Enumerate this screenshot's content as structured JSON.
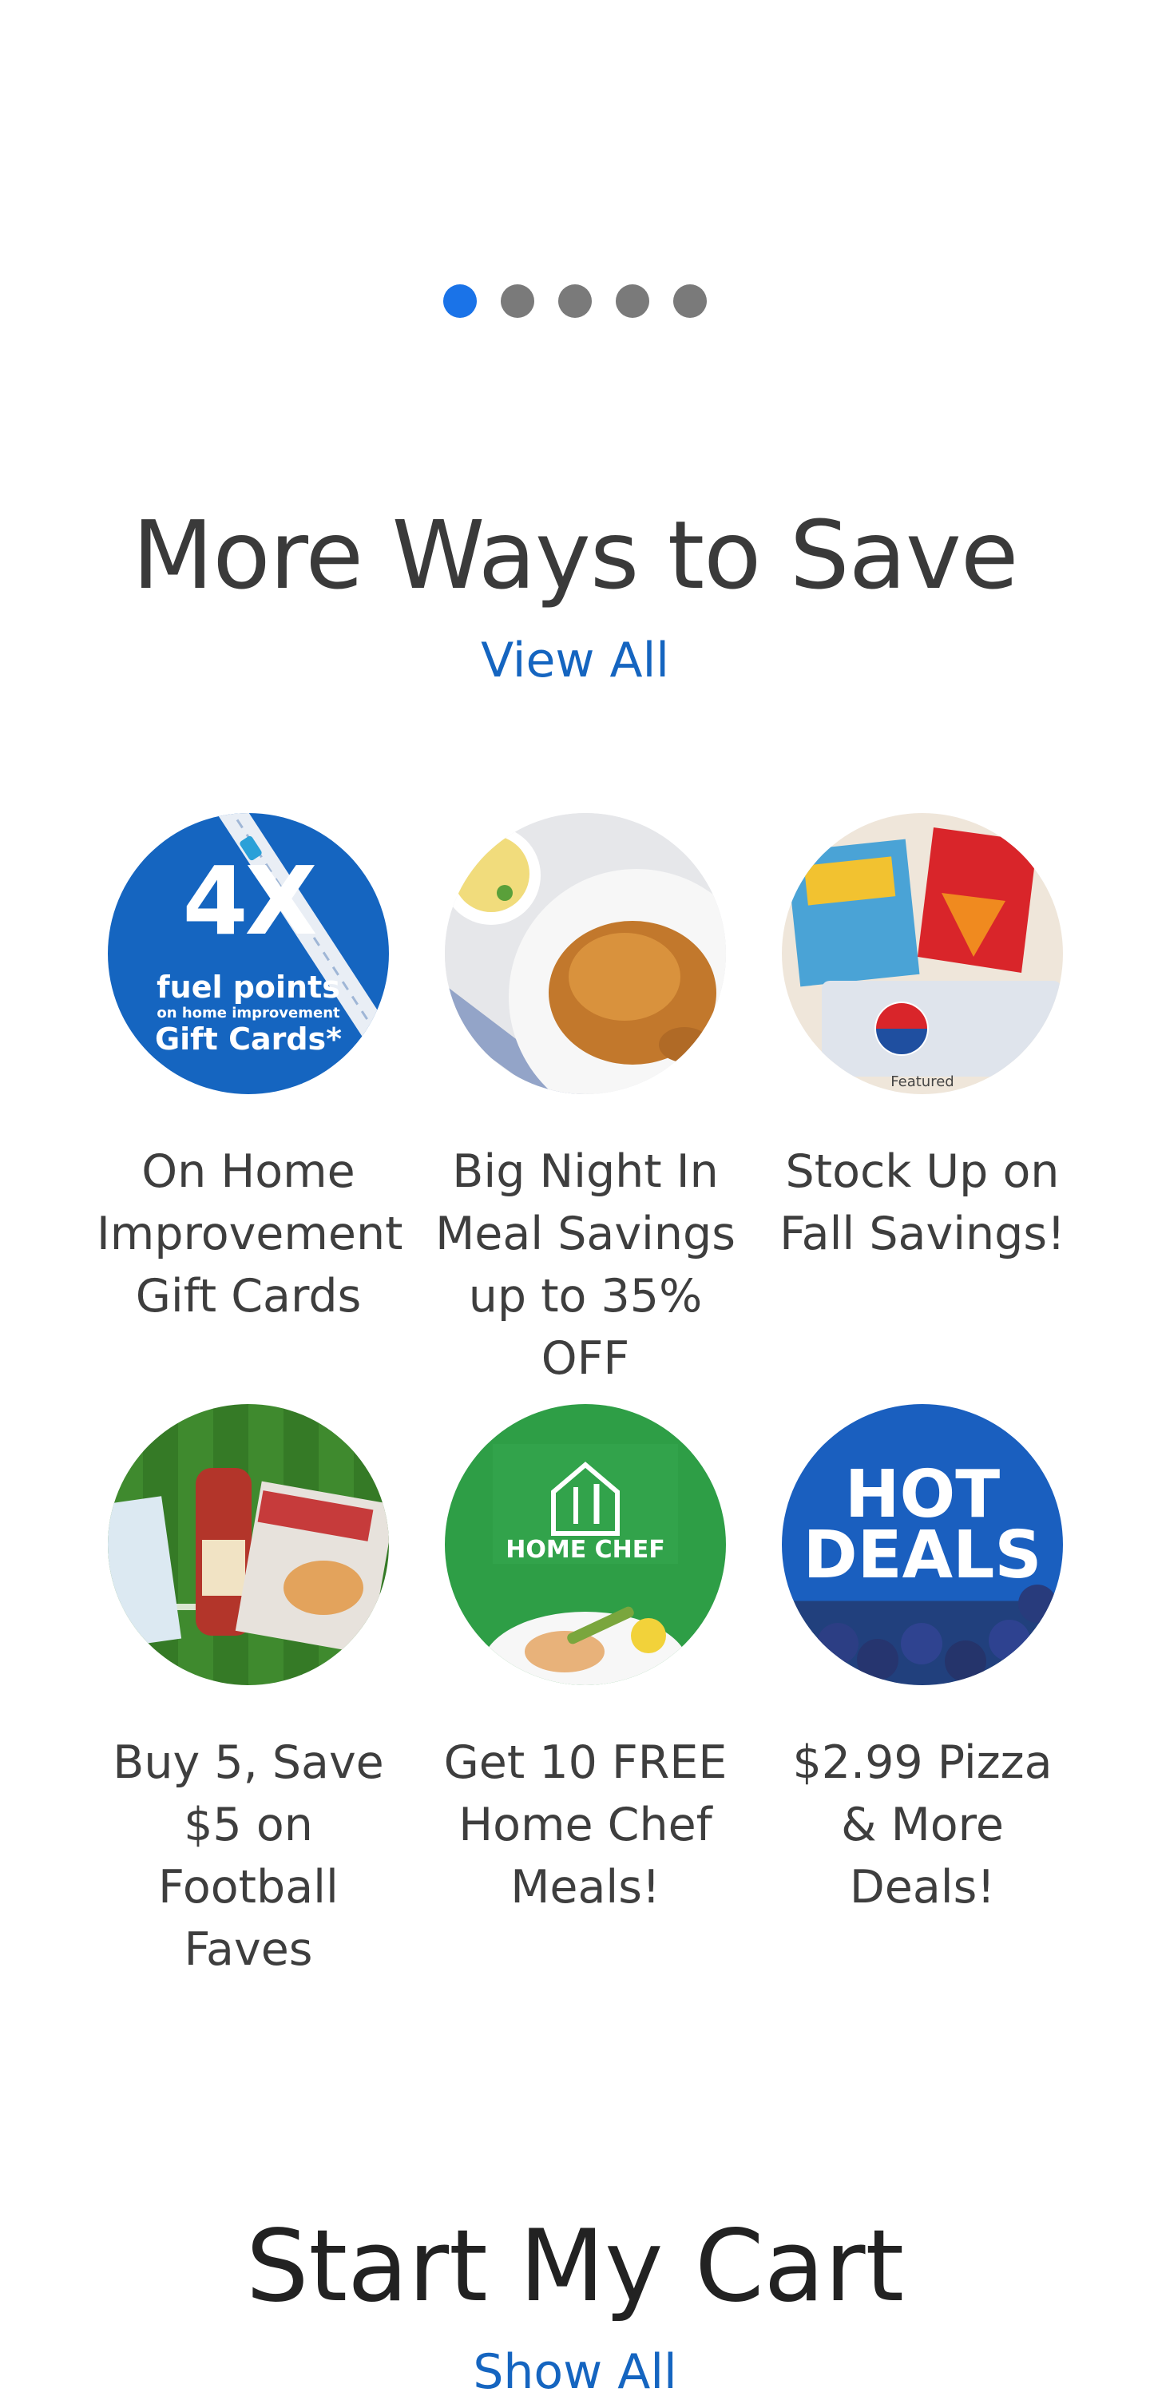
{
  "carousel": {
    "dot_count": 5,
    "active_index": 0
  },
  "more_ways": {
    "title": "More Ways to Save",
    "view_all": "View All",
    "tiles": [
      {
        "label": "On Home Improvement Gift Cards",
        "art_text": [
          "4X",
          "fuel points",
          "on home improvement",
          "Gift Cards*"
        ]
      },
      {
        "label": "Big Night In Meal Savings up to 35% OFF"
      },
      {
        "label": "Stock Up on Fall Savings!",
        "art_text": [
          "Featured"
        ]
      },
      {
        "label": "Buy 5, Save $5 on Football Faves"
      },
      {
        "label": "Get 10 FREE Home Chef Meals!",
        "art_text": [
          "HOME CHEF"
        ]
      },
      {
        "label": "$2.99 Pizza & More Deals!",
        "art_text": [
          "HOT",
          "DEALS"
        ]
      }
    ]
  },
  "start_my_cart": {
    "title": "Start My Cart",
    "show_all": "Show All"
  },
  "colors": {
    "active_dot": "#1a73e8",
    "inactive_dot": "#7a7a7a",
    "link": "#1565c0",
    "brand_blue": "#1565c0",
    "home_chef_green": "#2e9e46"
  }
}
